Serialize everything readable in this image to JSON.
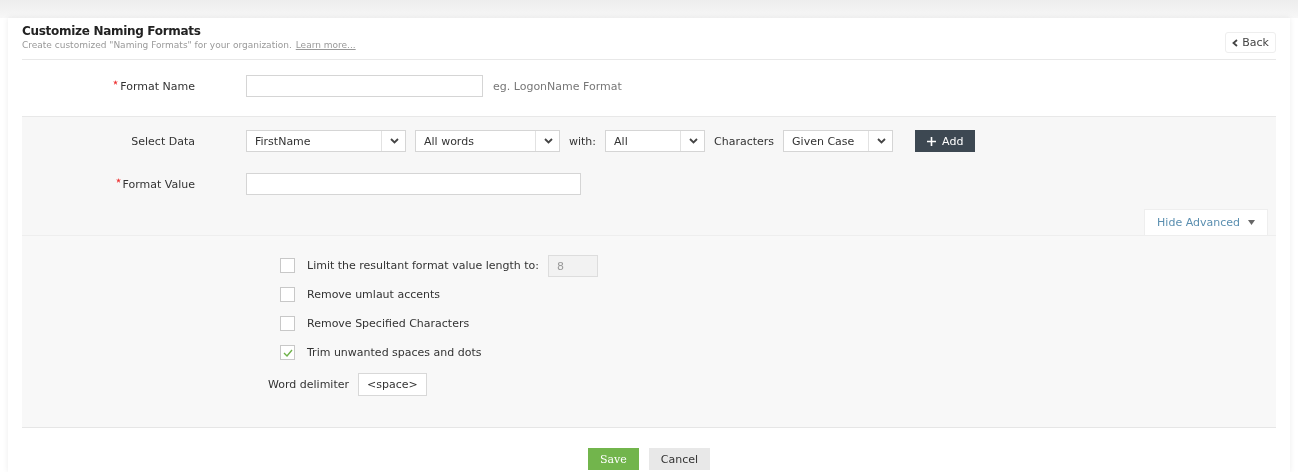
{
  "header": {
    "title": "Customize Naming Formats",
    "subtitle": "Create customized \"Naming Formats\" for your organization.",
    "learn_more": "Learn more...",
    "back_button": "Back"
  },
  "format_name": {
    "label": "Format Name",
    "required": true,
    "hint": "eg. LogonName Format"
  },
  "select_data": {
    "label": "Select Data",
    "items": [
      {
        "kind": "select",
        "value": "FirstName"
      },
      {
        "kind": "select",
        "value": "All words"
      },
      {
        "kind": "text",
        "value": "with:"
      },
      {
        "kind": "select",
        "value": "All"
      },
      {
        "kind": "text",
        "value": "Characters"
      },
      {
        "kind": "select",
        "value": "Given Case"
      }
    ],
    "add_button": "Add"
  },
  "format_value": {
    "label": "Format Value",
    "required": true
  },
  "advanced_toggle": {
    "label": "Hide Advanced",
    "expanded": true
  },
  "options": [
    {
      "label": "Limit the resultant format value length to:",
      "checked": false,
      "value": "8"
    },
    {
      "label": "Remove umlaut accents",
      "checked": false
    },
    {
      "label": "Remove Specified Characters",
      "checked": false
    },
    {
      "label": "Trim unwanted spaces and dots",
      "checked": true
    }
  ],
  "word_delimiter": {
    "label": "Word delimiter",
    "value": "<space>"
  },
  "buttons": [
    {
      "kind": "primary",
      "label": "Save"
    },
    {
      "kind": "secondary",
      "label": "Cancel"
    }
  ]
}
